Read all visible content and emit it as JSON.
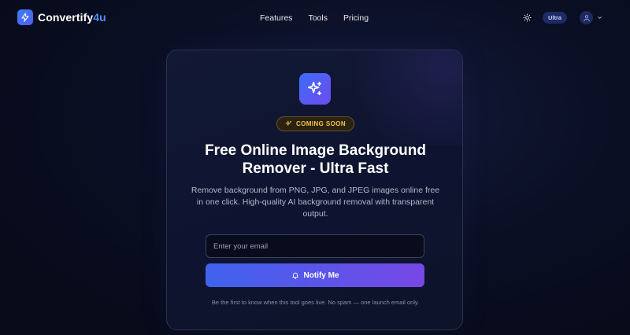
{
  "header": {
    "logo": {
      "name": "Convertify",
      "accent": "4u",
      "icon": "lightning-bolt-icon"
    },
    "nav": [
      {
        "label": "Features"
      },
      {
        "label": "Tools"
      },
      {
        "label": "Pricing"
      }
    ],
    "theme_icon": "sun-icon",
    "plan_badge": "Ultra",
    "user_icon": "user-icon",
    "chevron_icon": "chevron-down-icon"
  },
  "card": {
    "hero_icon": "sparkles-icon",
    "badge": {
      "icon": "sparkles-icon",
      "label": "COMING SOON"
    },
    "title": "Free Online Image Background Remover - Ultra Fast",
    "subtitle": "Remove background from PNG, JPG, and JPEG images online free in one click. High-quality AI background removal with transparent output.",
    "email": {
      "value": "",
      "placeholder": "Enter your email"
    },
    "notify_button": {
      "icon": "bell-icon",
      "label": "Notify Me"
    },
    "fine_print": "Be the first to know when this tool goes live. No spam — one launch email only."
  },
  "colors": {
    "background": "#070b1a",
    "accent_blue": "#3b82f6",
    "accent_purple": "#7848e6",
    "badge_gold": "#f6c343"
  }
}
